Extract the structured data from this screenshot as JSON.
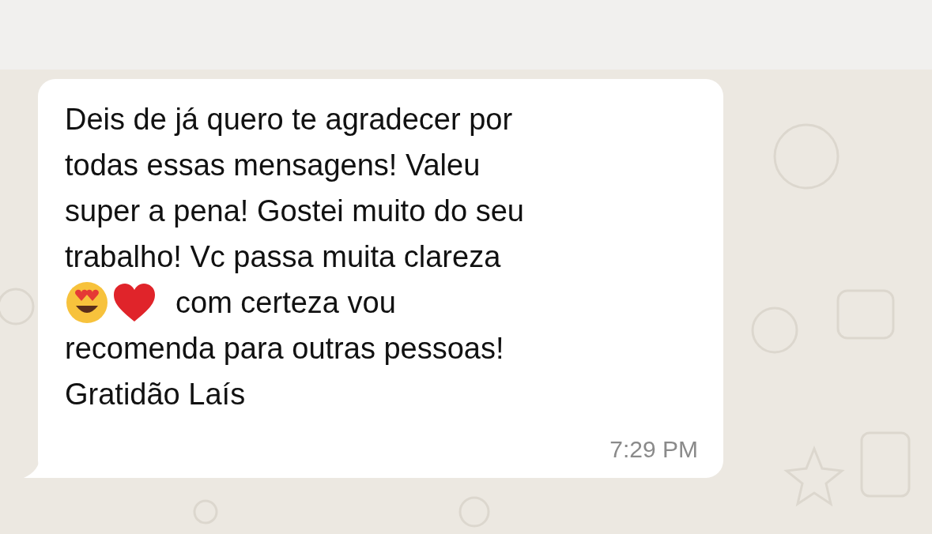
{
  "message": {
    "lines": [
      {
        "text": "Deis de já quero te agradecer por"
      },
      {
        "text": "todas essas mensagens! Valeu"
      },
      {
        "text": "super a pena! Gostei muito do seu"
      },
      {
        "text": "trabalho! Vc passa muita clareza"
      },
      {
        "emojis": [
          {
            "kind": "heart-eyes"
          },
          {
            "kind": "heart"
          }
        ],
        "text": "com certeza vou"
      },
      {
        "text": "recomenda para outras pessoas!"
      },
      {
        "text": "Gratidão Laís"
      }
    ],
    "time": "7:29 PM"
  }
}
